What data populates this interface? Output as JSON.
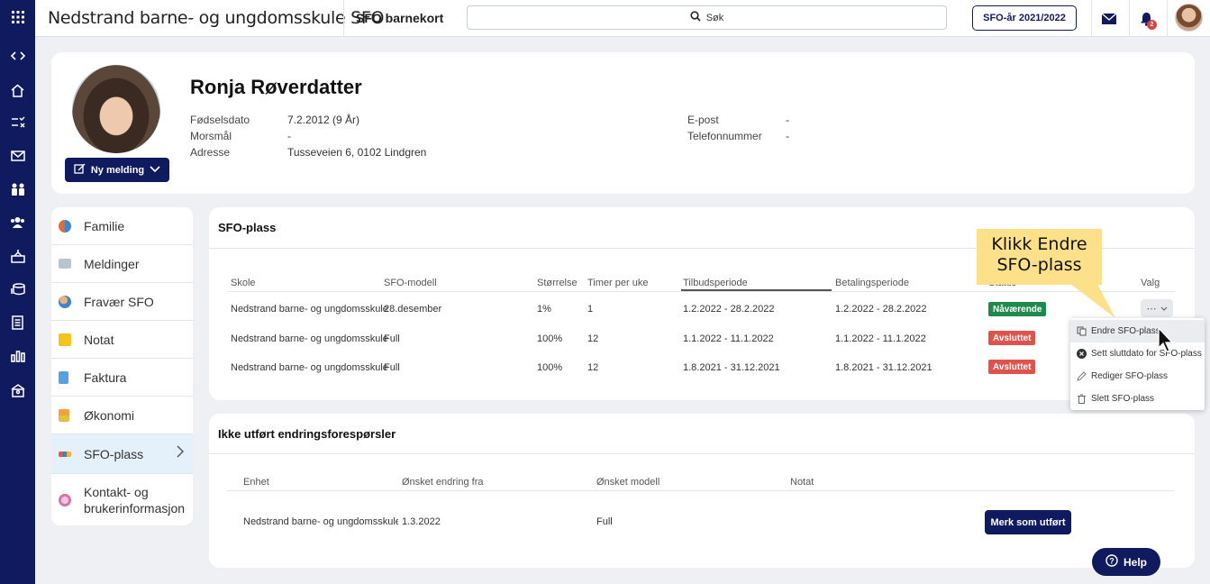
{
  "topbar": {
    "app_title": "Nedstrand barne- og ungdomsskule SFO",
    "page_name": "SFO barnekort",
    "search_label": "Søk",
    "year_button": "SFO-år 2021/2022",
    "notification_count": "2"
  },
  "profile": {
    "name": "Ronja Røverdatter",
    "new_message_button": "Ny melding",
    "fields_left": [
      {
        "label": "Fødselsdato",
        "value": "7.2.2012 (9 År)"
      },
      {
        "label": "Morsmål",
        "value": "-"
      },
      {
        "label": "Adresse",
        "value": "Tusseveien 6, 0102 Lindgren"
      }
    ],
    "fields_right": [
      {
        "label": "E-post",
        "value": "-"
      },
      {
        "label": "Telefonnummer",
        "value": "-"
      }
    ]
  },
  "side_menu": {
    "items": [
      {
        "label": "Familie",
        "icon": "family-icon"
      },
      {
        "label": "Meldinger",
        "icon": "envelope-icon"
      },
      {
        "label": "Fravær SFO",
        "icon": "absence-icon"
      },
      {
        "label": "Notat",
        "icon": "note-icon"
      },
      {
        "label": "Faktura",
        "icon": "invoice-icon"
      },
      {
        "label": "Økonomi",
        "icon": "economy-icon"
      },
      {
        "label": "SFO-plass",
        "icon": "sfo-place-icon",
        "active": true
      },
      {
        "label_line1": "Kontakt- og",
        "label_line2": "brukerinformasjon",
        "icon": "contact-info-icon"
      }
    ]
  },
  "sfo_plass": {
    "title": "SFO-plass",
    "columns": [
      "Skole",
      "SFO-modell",
      "Størrelse",
      "Timer per uke",
      "Tilbudsperiode",
      "Betalingsperiode",
      "Status",
      "Valg"
    ],
    "rows": [
      {
        "skole": "Nedstrand barne- og ungdomsskule",
        "modell": "28.desember",
        "storrelse": "1%",
        "timer": "1",
        "tilbud": "1.2.2022 - 28.2.2022",
        "betaling": "1.2.2022 - 28.2.2022",
        "status": "Nåværende",
        "status_color": "#1f8a4c"
      },
      {
        "skole": "Nedstrand barne- og ungdomsskule",
        "modell": "Full",
        "storrelse": "100%",
        "timer": "12",
        "tilbud": "1.1.2022 - 11.1.2022",
        "betaling": "1.1.2022 - 11.1.2022",
        "status": "Avsluttet",
        "status_color": "#e0524c"
      },
      {
        "skole": "Nedstrand barne- og ungdomsskule",
        "modell": "Full",
        "storrelse": "100%",
        "timer": "12",
        "tilbud": "1.8.2021 - 31.12.2021",
        "betaling": "1.8.2021 - 31.12.2021",
        "status": "Avsluttet",
        "status_color": "#e0524c"
      }
    ],
    "valg_button": "⋯"
  },
  "dropdown": {
    "items": [
      {
        "label": "Endre SFO-plass",
        "icon": "copy-icon"
      },
      {
        "label": "Sett sluttdato for SFO-plass",
        "icon": "close-circle-icon"
      },
      {
        "label": "Rediger SFO-plass",
        "icon": "pencil-icon"
      },
      {
        "label": "Slett SFO-plass",
        "icon": "trash-icon"
      }
    ]
  },
  "callout": {
    "line1": "Klikk Endre",
    "line2": "SFO-plass"
  },
  "endringer": {
    "title": "Ikke utført endringsforespørsler",
    "columns": [
      "Enhet",
      "Ønsket endring fra",
      "Ønsket modell",
      "Notat"
    ],
    "row": {
      "enhet": "Nedstrand barne- og ungdomsskule SFO",
      "fra": "1.3.2022",
      "modell": "Full",
      "notat": ""
    },
    "button": "Merk som utført"
  },
  "help_button": "Help",
  "colors": {
    "navy": "#101a5e",
    "green": "#1f8a4c",
    "red": "#e0524c",
    "callout": "#fce18a"
  }
}
